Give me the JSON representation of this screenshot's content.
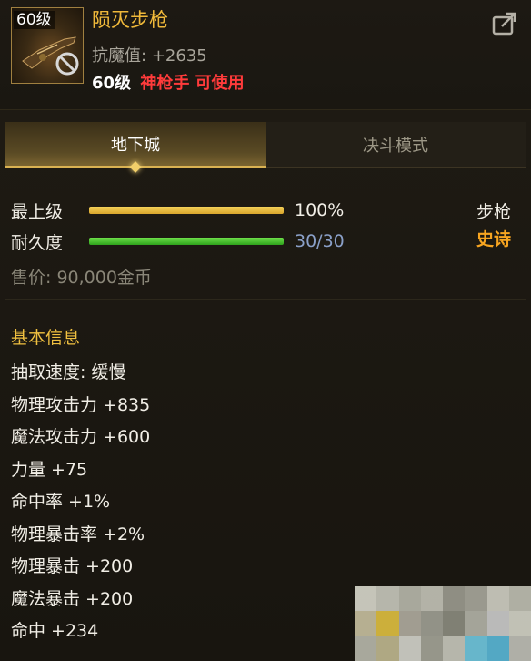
{
  "item": {
    "level_badge": "60级",
    "name": "陨灭步枪",
    "resist_label": "抗魔值:",
    "resist_value": "+2635",
    "req_level": "60级",
    "req_class": "神枪手 可使用",
    "icon": "rifle-icon"
  },
  "tabs": [
    {
      "label": "地下城",
      "active": true
    },
    {
      "label": "决斗模式",
      "active": false
    }
  ],
  "stats": {
    "upgrade": {
      "label": "最上级",
      "value": "100%",
      "fraction": 1.0
    },
    "durability": {
      "label": "耐久度",
      "value": "30/30",
      "fraction": 1.0
    }
  },
  "weapon_type": "步枪",
  "rarity": "史诗",
  "price": "售价: 90,000金币",
  "basic_info": {
    "title": "基本信息",
    "lines": [
      "抽取速度: 缓慢",
      "物理攻击力 +835",
      "魔法攻击力 +600",
      "力量 +75",
      "命中率 +1%",
      "物理暴击率 +2%",
      "物理暴击 +200",
      "魔法暴击 +200",
      "命中 +234"
    ]
  },
  "colors": {
    "name": "#f0b93a",
    "class_req": "#ff3b3b",
    "rarity_epic": "#f7a520",
    "section_title": "#f0c040",
    "upgrade_bar": "#e8bc3c",
    "durability_bar": "#3cc228"
  }
}
